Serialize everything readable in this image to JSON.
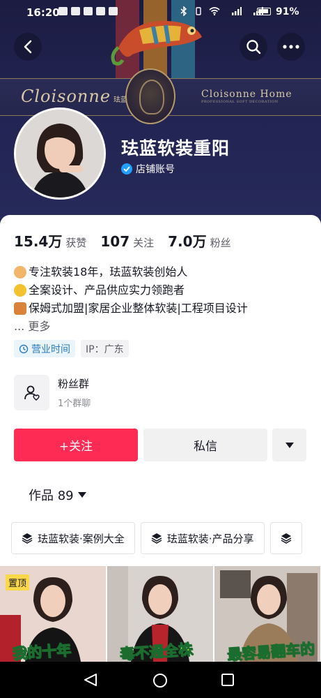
{
  "status_bar": {
    "time": "16:20",
    "battery": "91%"
  },
  "banner": {
    "brand_left": "Cloisonne",
    "brand_left_cn": "珐蓝",
    "brand_right": "Cloisonne Home",
    "brand_right_sub": "PROFESSIONAL SOFT DECORATION"
  },
  "profile": {
    "name": "珐蓝软装重阳",
    "badge_text": "店铺账号"
  },
  "stats": [
    {
      "num": "15.4万",
      "label": "获赞"
    },
    {
      "num": "107",
      "label": "关注"
    },
    {
      "num": "7.0万",
      "label": "粉丝"
    }
  ],
  "bio": [
    {
      "icon": "woman-office-worker-emoji",
      "text": "专注软装18年，珐蓝软装创始人"
    },
    {
      "icon": "medal-emoji",
      "text": "全案设计、产品供应实力领跑者"
    },
    {
      "icon": "house-emoji",
      "text": "保姆式加盟|家居企业整体软装|工程项目设计"
    }
  ],
  "bio_more": "...  更多",
  "tags": {
    "hours": "营业时间",
    "ip": "IP：广东"
  },
  "fans_group": {
    "title": "粉丝群",
    "sub": "1个群聊"
  },
  "actions": {
    "follow": "+关注",
    "message": "私信"
  },
  "works": {
    "label": "作品 89"
  },
  "collections": [
    "珐蓝软装·案例大全",
    "珐蓝软装·产品分享"
  ],
  "videos": [
    {
      "pinned": "置顶",
      "caption": "我的十年"
    },
    {
      "caption": "毒不通全株"
    },
    {
      "caption": "最容易翻车的"
    }
  ],
  "colors": {
    "accent": "#fe2c55",
    "banner": "#222452",
    "verify": "#20a0ff"
  }
}
